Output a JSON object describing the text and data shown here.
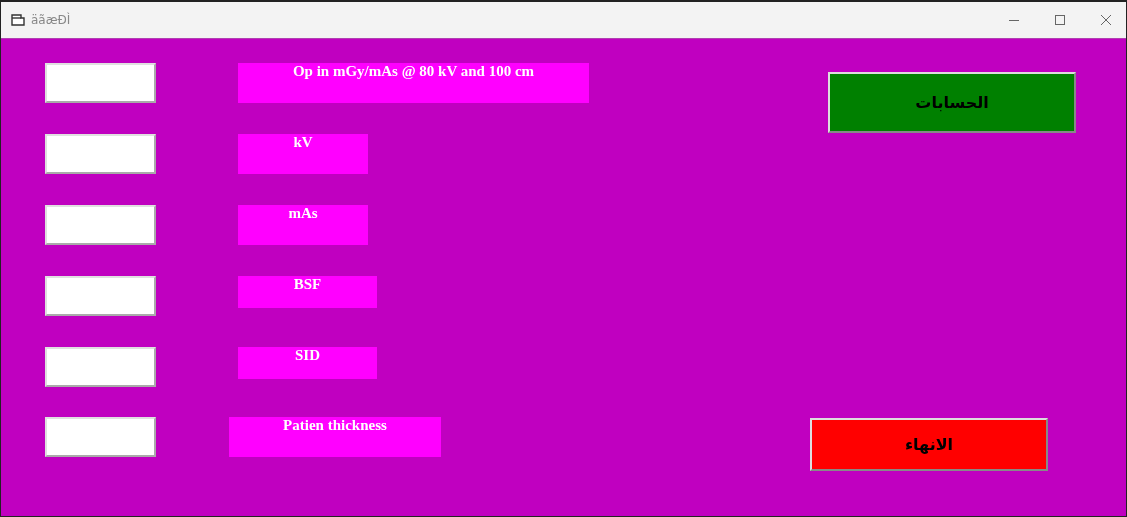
{
  "window": {
    "title": "äãæÐÌ"
  },
  "fields": [
    {
      "label": "Op in mGy/mAs @ 80 kV and 100 cm"
    },
    {
      "label": "kV"
    },
    {
      "label": "mAs"
    },
    {
      "label": "BSF"
    },
    {
      "label": "SID"
    },
    {
      "label": "Patien thickness"
    }
  ],
  "buttons": [
    {
      "label": "الحسابات",
      "color": "#008000"
    },
    {
      "label": "الانهاء",
      "color": "#ff0000"
    }
  ]
}
